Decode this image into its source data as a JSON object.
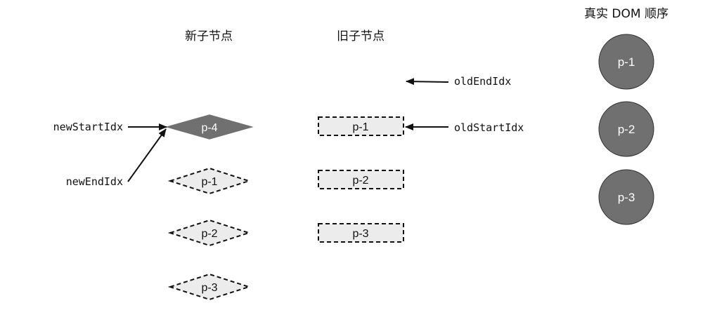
{
  "headers": {
    "new_children": "新子节点",
    "old_children": "旧子节点",
    "real_dom": "真实 DOM 顺序"
  },
  "pointers": {
    "new_start_idx": "newStartIdx",
    "new_end_idx": "newEndIdx",
    "old_start_idx": "oldStartIdx",
    "old_end_idx": "oldEndIdx"
  },
  "new_nodes": [
    {
      "label": "p-4",
      "state": "processing"
    },
    {
      "label": "p-1",
      "state": "pending"
    },
    {
      "label": "p-2",
      "state": "pending"
    },
    {
      "label": "p-3",
      "state": "pending"
    }
  ],
  "old_nodes": [
    {
      "label": "p-1",
      "state": "pending"
    },
    {
      "label": "p-2",
      "state": "pending"
    },
    {
      "label": "p-3",
      "state": "pending"
    }
  ],
  "dom_nodes": [
    {
      "label": "p-1"
    },
    {
      "label": "p-2"
    },
    {
      "label": "p-3"
    }
  ],
  "colors": {
    "processing_fill": "#707070",
    "pending_fill": "#ececec",
    "dom_fill": "#707070",
    "stroke": "#111111"
  }
}
